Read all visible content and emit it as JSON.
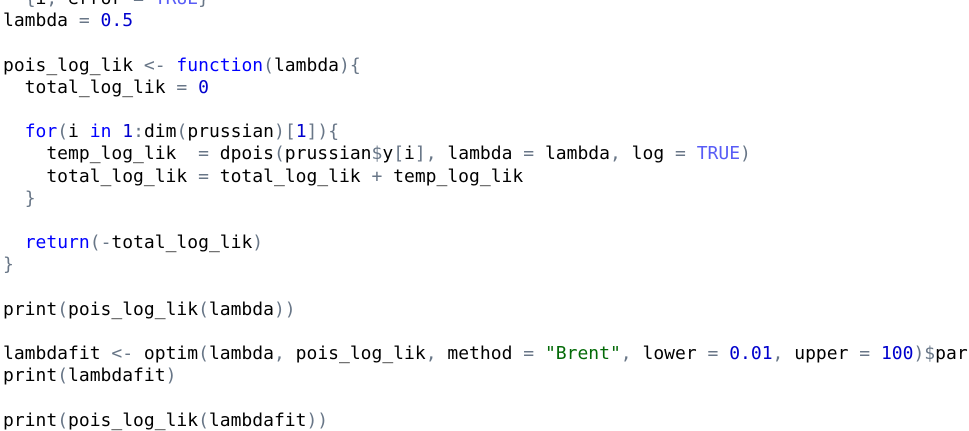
{
  "editor": {
    "colors": {
      "background": "#ffffff",
      "text": "#000000",
      "keyword": "#0000ff",
      "number": "#0000cd",
      "string": "#036a07",
      "boolean": "#585cf6",
      "operator": "#687687"
    },
    "lines": [
      [
        [
          "text",
          "  "
        ],
        [
          "paren",
          "{"
        ],
        [
          "text",
          "i"
        ],
        [
          "op",
          ","
        ],
        [
          "text",
          " error "
        ],
        [
          "op",
          "="
        ],
        [
          "text",
          " "
        ],
        [
          "bool",
          "TRUE"
        ],
        [
          "paren",
          "}"
        ]
      ],
      [
        [
          "text",
          "lambda "
        ],
        [
          "op",
          "="
        ],
        [
          "text",
          " "
        ],
        [
          "number",
          "0.5"
        ]
      ],
      [],
      [
        [
          "text",
          "pois_log_lik "
        ],
        [
          "op",
          "<-"
        ],
        [
          "text",
          " "
        ],
        [
          "keyword",
          "function"
        ],
        [
          "paren",
          "("
        ],
        [
          "text",
          "lambda"
        ],
        [
          "paren",
          ")"
        ],
        [
          "paren",
          "{"
        ]
      ],
      [
        [
          "text",
          "  total_log_lik "
        ],
        [
          "op",
          "="
        ],
        [
          "text",
          " "
        ],
        [
          "number",
          "0"
        ]
      ],
      [],
      [
        [
          "text",
          "  "
        ],
        [
          "keyword",
          "for"
        ],
        [
          "paren",
          "("
        ],
        [
          "text",
          "i "
        ],
        [
          "keyword",
          "in"
        ],
        [
          "text",
          " "
        ],
        [
          "number",
          "1"
        ],
        [
          "op",
          ":"
        ],
        [
          "text",
          "dim"
        ],
        [
          "paren",
          "("
        ],
        [
          "text",
          "prussian"
        ],
        [
          "paren",
          ")"
        ],
        [
          "paren",
          "["
        ],
        [
          "number",
          "1"
        ],
        [
          "paren",
          "]"
        ],
        [
          "paren",
          ")"
        ],
        [
          "paren",
          "{"
        ]
      ],
      [
        [
          "text",
          "    temp_log_lik  "
        ],
        [
          "op",
          "="
        ],
        [
          "text",
          " dpois"
        ],
        [
          "paren",
          "("
        ],
        [
          "text",
          "prussian"
        ],
        [
          "op",
          "$"
        ],
        [
          "text",
          "y"
        ],
        [
          "paren",
          "["
        ],
        [
          "text",
          "i"
        ],
        [
          "paren",
          "]"
        ],
        [
          "op",
          ","
        ],
        [
          "text",
          " lambda "
        ],
        [
          "op",
          "="
        ],
        [
          "text",
          " lambda"
        ],
        [
          "op",
          ","
        ],
        [
          "text",
          " log "
        ],
        [
          "op",
          "="
        ],
        [
          "text",
          " "
        ],
        [
          "bool",
          "TRUE"
        ],
        [
          "paren",
          ")"
        ]
      ],
      [
        [
          "text",
          "    total_log_lik "
        ],
        [
          "op",
          "="
        ],
        [
          "text",
          " total_log_lik "
        ],
        [
          "op",
          "+"
        ],
        [
          "text",
          " temp_log_lik"
        ]
      ],
      [
        [
          "text",
          "  "
        ],
        [
          "paren",
          "}"
        ]
      ],
      [],
      [
        [
          "text",
          "  "
        ],
        [
          "keyword",
          "return"
        ],
        [
          "paren",
          "("
        ],
        [
          "op",
          "-"
        ],
        [
          "text",
          "total_log_lik"
        ],
        [
          "paren",
          ")"
        ]
      ],
      [
        [
          "paren",
          "}"
        ]
      ],
      [],
      [
        [
          "text",
          "print"
        ],
        [
          "paren",
          "("
        ],
        [
          "text",
          "pois_log_lik"
        ],
        [
          "paren",
          "("
        ],
        [
          "text",
          "lambda"
        ],
        [
          "paren",
          "))"
        ]
      ],
      [],
      [
        [
          "text",
          "lambdafit "
        ],
        [
          "op",
          "<-"
        ],
        [
          "text",
          " optim"
        ],
        [
          "paren",
          "("
        ],
        [
          "text",
          "lambda"
        ],
        [
          "op",
          ","
        ],
        [
          "text",
          " pois_log_lik"
        ],
        [
          "op",
          ","
        ],
        [
          "text",
          " method "
        ],
        [
          "op",
          "="
        ],
        [
          "text",
          " "
        ],
        [
          "string",
          "\"Brent\""
        ],
        [
          "op",
          ","
        ],
        [
          "text",
          " lower "
        ],
        [
          "op",
          "="
        ],
        [
          "text",
          " "
        ],
        [
          "number",
          "0.01"
        ],
        [
          "op",
          ","
        ],
        [
          "text",
          " upper "
        ],
        [
          "op",
          "="
        ],
        [
          "text",
          " "
        ],
        [
          "number",
          "100"
        ],
        [
          "paren",
          ")"
        ],
        [
          "op",
          "$"
        ],
        [
          "text",
          "par"
        ]
      ],
      [
        [
          "text",
          "print"
        ],
        [
          "paren",
          "("
        ],
        [
          "text",
          "lambdafit"
        ],
        [
          "paren",
          ")"
        ]
      ],
      [],
      [
        [
          "text",
          "print"
        ],
        [
          "paren",
          "("
        ],
        [
          "text",
          "pois_log_lik"
        ],
        [
          "paren",
          "("
        ],
        [
          "text",
          "lambdafit"
        ],
        [
          "paren",
          "))"
        ]
      ]
    ]
  }
}
